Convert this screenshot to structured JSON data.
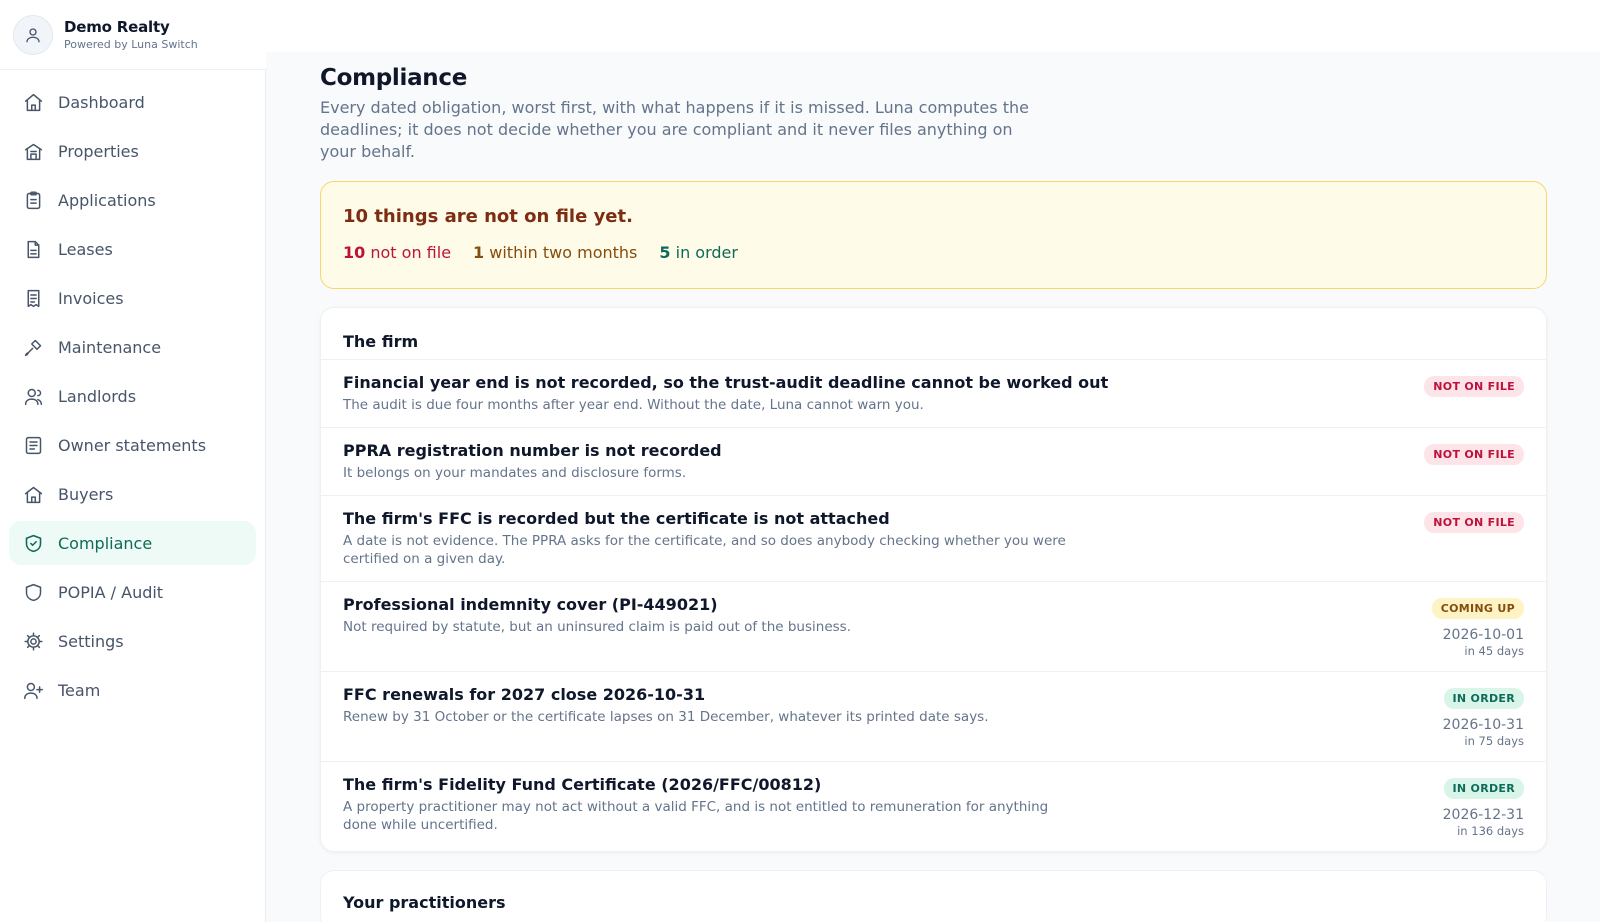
{
  "brand": {
    "name": "Demo Realty",
    "subtitle": "Powered by Luna Switch"
  },
  "sidebar": {
    "items": [
      {
        "label": "Dashboard",
        "icon": "home-icon"
      },
      {
        "label": "Properties",
        "icon": "building-icon"
      },
      {
        "label": "Applications",
        "icon": "clipboard-icon"
      },
      {
        "label": "Leases",
        "icon": "file-icon"
      },
      {
        "label": "Invoices",
        "icon": "receipt-icon"
      },
      {
        "label": "Maintenance",
        "icon": "wrench-icon"
      },
      {
        "label": "Landlords",
        "icon": "user-icon"
      },
      {
        "label": "Owner statements",
        "icon": "document-list-icon"
      },
      {
        "label": "Buyers",
        "icon": "house-icon"
      },
      {
        "label": "Compliance",
        "icon": "shield-check-icon",
        "active": true
      },
      {
        "label": "POPIA / Audit",
        "icon": "shield-icon"
      },
      {
        "label": "Settings",
        "icon": "gear-icon"
      },
      {
        "label": "Team",
        "icon": "user-plus-icon"
      }
    ]
  },
  "page": {
    "title": "Compliance",
    "description": "Every dated obligation, worst first, with what happens if it is missed. Luna computes the deadlines; it does not decide whether you are compliant and it never files anything on your behalf."
  },
  "alert": {
    "title": "10 things are not on file yet.",
    "not_on_file_count": "10",
    "not_on_file_label": "not on file",
    "within_count": "1",
    "within_label": "within two months",
    "in_order_count": "5",
    "in_order_label": "in order"
  },
  "firm": {
    "heading": "The firm",
    "rows": [
      {
        "title": "Financial year end is not recorded, so the trust-audit deadline cannot be worked out",
        "subtitle": "The audit is due four months after year end. Without the date, Luna cannot warn you.",
        "status": "NOT ON FILE",
        "date": "",
        "in": ""
      },
      {
        "title": "PPRA registration number is not recorded",
        "subtitle": "It belongs on your mandates and disclosure forms.",
        "status": "NOT ON FILE",
        "date": "",
        "in": ""
      },
      {
        "title": "The firm's FFC is recorded but the certificate is not attached",
        "subtitle": "A date is not evidence. The PPRA asks for the certificate, and so does anybody checking whether you were certified on a given day.",
        "status": "NOT ON FILE",
        "date": "",
        "in": ""
      },
      {
        "title": "Professional indemnity cover (PI-449021)",
        "subtitle": "Not required by statute, but an uninsured claim is paid out of the business.",
        "status": "COMING UP",
        "date": "2026-10-01",
        "in": "in 45 days"
      },
      {
        "title": "FFC renewals for 2027 close 2026-10-31",
        "subtitle": "Renew by 31 October or the certificate lapses on 31 December, whatever its printed date says.",
        "status": "IN ORDER",
        "date": "2026-10-31",
        "in": "in 75 days"
      },
      {
        "title": "The firm's Fidelity Fund Certificate (2026/FFC/00812)",
        "subtitle": "A property practitioner may not act without a valid FFC, and is not entitled to remuneration for anything done while uncertified.",
        "status": "IN ORDER",
        "date": "2026-12-31",
        "in": "in 136 days"
      }
    ]
  },
  "practitioners": {
    "heading": "Your practitioners"
  },
  "colors": {
    "accent": "#0f6b59",
    "danger": "#be123c",
    "warning": "#854d0e",
    "alert_bg": "#fefbe8"
  }
}
